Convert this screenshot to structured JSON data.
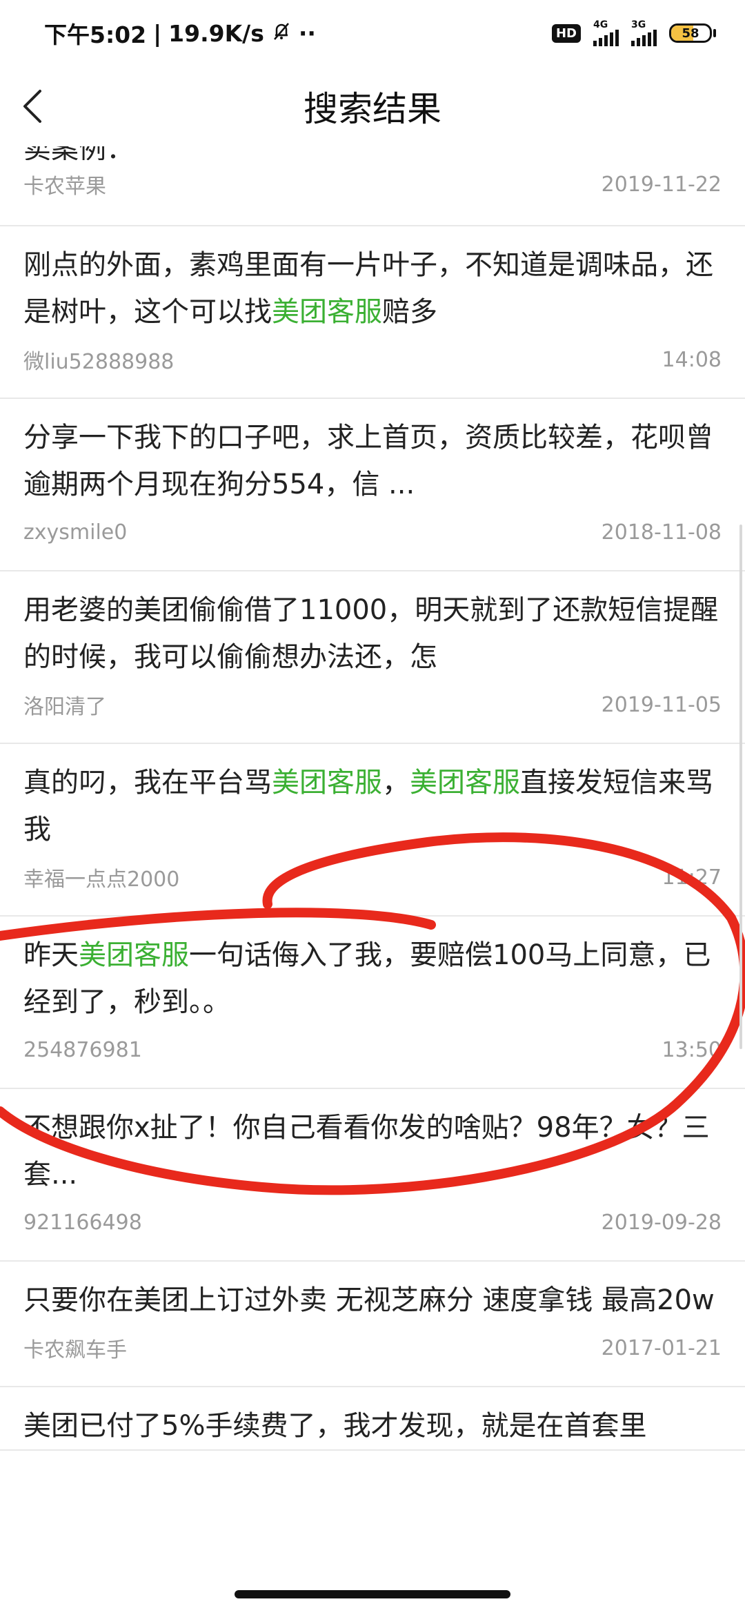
{
  "status_bar": {
    "time": "下午5:02",
    "network_speed": "19.9K/s",
    "hd_label": "HD",
    "net1": "4G",
    "net2": "3G",
    "battery": "58",
    "battery_level": 0.58
  },
  "header": {
    "title": "搜索结果"
  },
  "results": [
    {
      "title": "卖案例：",
      "author": "卡农苹果",
      "date": "2019-11-22"
    },
    {
      "title_parts": [
        "刚点的外面，素鸡里面有一片叶子，不知道是调味品，还是树叶，这个可以找",
        "美团客服",
        "赔多"
      ],
      "author": "微liu52888988",
      "date": "14:08"
    },
    {
      "title": "分享一下我下的口子吧，求上首页，资质比较差，花呗曾逾期两个月现在狗分554，信 ...",
      "author": "zxysmile0",
      "date": "2018-11-08"
    },
    {
      "title": "用老婆的美团偷偷借了11000，明天就到了还款短信提醒的时候，我可以偷偷想办法还，怎",
      "author": "洛阳清了",
      "date": "2019-11-05"
    },
    {
      "title_parts": [
        "真的叼，我在平台骂",
        "美团客服",
        "，",
        "美团客服",
        "直接发短信来骂我"
      ],
      "author": "幸福一点点2000",
      "date": "11:27"
    },
    {
      "title_parts": [
        "昨天",
        "美团客服",
        "一句话侮入了我，要赔偿100马上同意，已经到了，秒到。。"
      ],
      "author": "254876981",
      "date": "13:50"
    },
    {
      "title": "不想跟你x扯了！你自己看看你发的啥贴？98年？女？三套...",
      "author": "921166498",
      "date": "2019-09-28"
    },
    {
      "title": "只要你在美团上订过外卖 无视芝麻分 速度拿钱 最高20w",
      "author": "卡农飙车手",
      "date": "2017-01-21"
    },
    {
      "title": "美团已付了5%手续费了，我才发现，就是在首套里",
      "author": "",
      "date": ""
    }
  ]
}
